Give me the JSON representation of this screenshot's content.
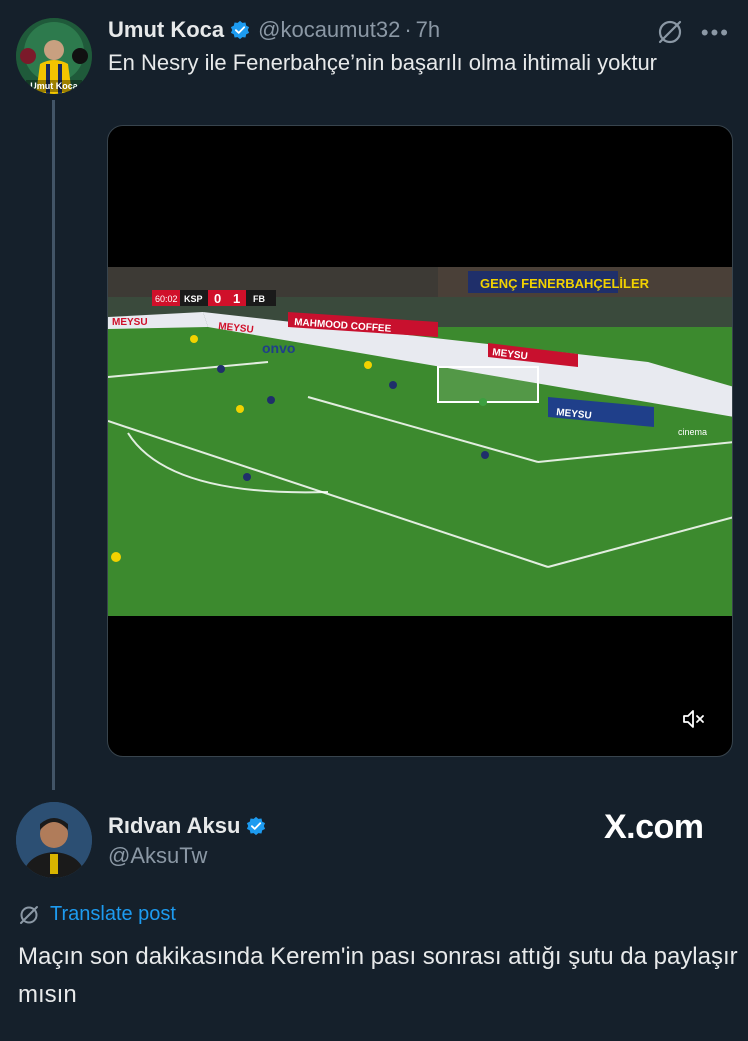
{
  "tweet": {
    "author_name": "Umut Koca",
    "handle": "@kocaumut32",
    "separator": "·",
    "time": "7h",
    "text": "En Nesry ile Fenerbahçe’nin başarılı olma ihtimali yoktur",
    "avatar_text": "Umut Koca",
    "video": {
      "scoreboard": {
        "clock": "60:02",
        "home": "KSP",
        "home_score": "0",
        "away_score": "1",
        "away": "FB"
      },
      "ads": [
        "MEYSU",
        "MAHMOOD COFFEE",
        "GENÇ FENERBAHÇELİLER",
        "onvo",
        "cinema"
      ]
    }
  },
  "quote": {
    "author_name": "Rıdvan Aksu",
    "handle": "@AksuTw",
    "translate_label": "Translate post",
    "text": "Maçın son dakikasında Kerem'in pası sonrası attığı şutu da paylaşır mısın"
  },
  "watermark": "X.com",
  "colors": {
    "background": "#15202b",
    "accent": "#1d9bf0",
    "text": "#e7e9ea",
    "muted": "#8b98a5"
  }
}
